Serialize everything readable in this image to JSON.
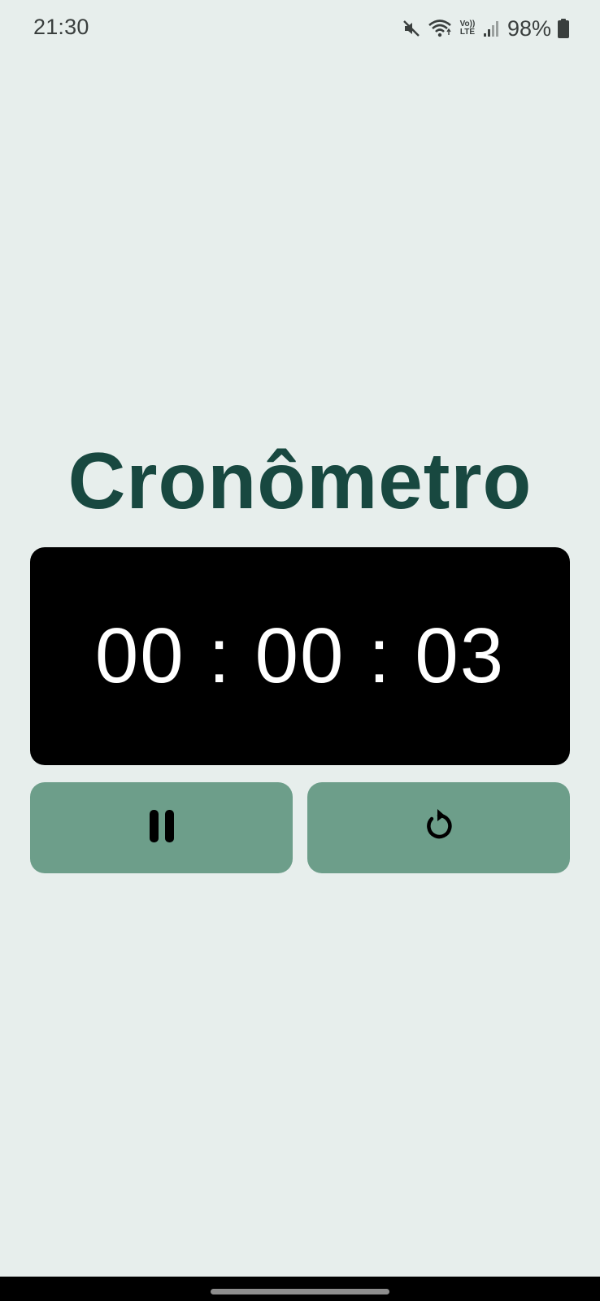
{
  "status_bar": {
    "time": "21:30",
    "icons": [
      "mute-icon",
      "wifi-icon",
      "volte-icon",
      "signal-icon",
      "battery-icon"
    ],
    "volte_top": "Vo))",
    "volte_bottom": "LTE",
    "battery": "98%"
  },
  "app": {
    "title": "Cronômetro",
    "timer": "00 : 00 : 03"
  },
  "buttons": {
    "pause_icon": "pause-icon",
    "reset_icon": "reset-icon"
  },
  "colors": {
    "background": "#e7eeec",
    "title": "#184840",
    "timer_panel": "#000000",
    "timer_text": "#ffffff",
    "button": "#6d9e8a"
  }
}
